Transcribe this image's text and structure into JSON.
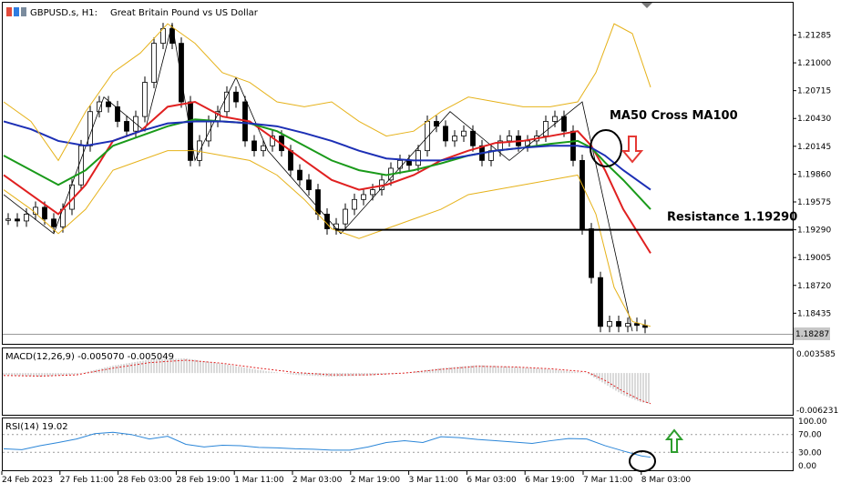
{
  "header": {
    "symbol": "GBPUSD.s, H1:",
    "description": "Great Britain Pound vs US Dollar"
  },
  "price_axis": {
    "ticks": [
      "1.21285",
      "1.21000",
      "1.20715",
      "1.20430",
      "1.20145",
      "1.19860",
      "1.19575",
      "1.19290",
      "1.19005",
      "1.18720",
      "1.18435"
    ],
    "current_price": "1.18287"
  },
  "annotations": {
    "cross_label": "MA50 Cross MA100",
    "resistance_label": "Resistance 1.19290",
    "colors": {
      "down_arrow": "#e53935",
      "up_arrow": "#2e9e2e",
      "resistance_line": "#000000"
    }
  },
  "macd": {
    "label": "MACD(12,26,9) -0.005070 -0.005049",
    "scale_top": "0.003585",
    "scale_bottom": "-0.006231"
  },
  "rsi": {
    "label": "RSI(14) 19.02",
    "levels": [
      "100.00",
      "70.00",
      "30.00",
      "0.00"
    ]
  },
  "time_axis": {
    "labels": [
      "24 Feb 2023",
      "27 Feb 11:00",
      "28 Feb 03:00",
      "28 Feb 19:00",
      "1 Mar 11:00",
      "2 Mar 03:00",
      "2 Mar 19:00",
      "3 Mar 11:00",
      "6 Mar 03:00",
      "6 Mar 19:00",
      "7 Mar 11:00",
      "8 Mar 03:00"
    ]
  },
  "chart_data": {
    "type": "line",
    "symbol": "GBPUSD",
    "timeframe": "H1",
    "price_range": [
      1.1814,
      1.2142
    ],
    "resistance": 1.1929,
    "series": [
      {
        "key": "price",
        "x": [
          0,
          10,
          20,
          30,
          40,
          50,
          60,
          70,
          80,
          90,
          100,
          110,
          120,
          130,
          140,
          150,
          160,
          170,
          180,
          190,
          200,
          210,
          220,
          230,
          240,
          250,
          260,
          270,
          280,
          290,
          300,
          310,
          320,
          330,
          340,
          350,
          360,
          370,
          380,
          390,
          400,
          410,
          420,
          430,
          440,
          450,
          460,
          470,
          480,
          490,
          500,
          510,
          520,
          530,
          540,
          550,
          560,
          570,
          580,
          590,
          600,
          610,
          620,
          630,
          640,
          650,
          660,
          670,
          680,
          690,
          700,
          708
        ],
        "y": [
          1.194,
          1.194,
          1.1938,
          1.1945,
          1.1952,
          1.194,
          1.1932,
          1.195,
          1.1975,
          1.2015,
          1.205,
          1.206,
          1.2055,
          1.204,
          1.203,
          1.2045,
          1.208,
          1.212,
          1.2135,
          1.212,
          1.206,
          1.2,
          1.202,
          1.204,
          1.205,
          1.207,
          1.206,
          1.202,
          1.201,
          1.2015,
          1.2025,
          1.201,
          1.199,
          1.198,
          1.197,
          1.1945,
          1.193,
          1.1935,
          1.195,
          1.196,
          1.1965,
          1.197,
          1.198,
          1.1992,
          1.2,
          1.1995,
          1.201,
          1.204,
          1.2035,
          1.202,
          1.2025,
          1.203,
          1.2015,
          1.2,
          1.201,
          1.202,
          1.2025,
          1.2015,
          1.202,
          1.2025,
          1.204,
          1.2045,
          1.203,
          1.2,
          1.193,
          1.188,
          1.183,
          1.1835,
          1.183,
          1.1833,
          1.1831,
          1.1829
        ]
      },
      {
        "key": "ma_red",
        "color": "#e02020",
        "x": [
          0,
          30,
          60,
          90,
          120,
          150,
          180,
          210,
          240,
          270,
          300,
          330,
          360,
          390,
          420,
          450,
          480,
          510,
          540,
          570,
          600,
          630,
          645,
          660,
          680,
          710
        ],
        "y": [
          1.1985,
          1.1965,
          1.1945,
          1.1975,
          1.202,
          1.203,
          1.2055,
          1.206,
          1.2045,
          1.204,
          1.202,
          1.2,
          1.198,
          1.197,
          1.1975,
          1.1985,
          1.2,
          1.201,
          1.2018,
          1.202,
          1.2025,
          1.203,
          1.2015,
          1.199,
          1.195,
          1.1905
        ]
      },
      {
        "key": "ma_green",
        "color": "#1a9a1a",
        "x": [
          0,
          30,
          60,
          90,
          120,
          150,
          180,
          210,
          240,
          270,
          300,
          330,
          360,
          390,
          420,
          450,
          480,
          510,
          540,
          570,
          600,
          630,
          645,
          660,
          680,
          710
        ],
        "y": [
          1.2005,
          1.199,
          1.1975,
          1.199,
          1.2015,
          1.2025,
          1.2035,
          1.2042,
          1.204,
          1.2038,
          1.203,
          1.2015,
          1.2,
          1.199,
          1.1985,
          1.199,
          1.1997,
          1.2005,
          1.201,
          1.2013,
          1.2017,
          1.202,
          1.2013,
          1.1998,
          1.198,
          1.195
        ]
      },
      {
        "key": "ma_blue",
        "color": "#1c2fb5",
        "x": [
          0,
          30,
          60,
          90,
          120,
          150,
          180,
          210,
          240,
          270,
          300,
          330,
          360,
          390,
          420,
          450,
          480,
          510,
          540,
          570,
          600,
          630,
          645,
          660,
          680,
          710
        ],
        "y": [
          1.204,
          1.2032,
          1.202,
          1.2015,
          1.202,
          1.203,
          1.2038,
          1.204,
          1.204,
          1.2038,
          1.2035,
          1.2028,
          1.202,
          1.201,
          1.2002,
          1.2,
          1.2,
          1.2005,
          1.201,
          1.2013,
          1.2015,
          1.2015,
          1.2013,
          1.2005,
          1.199,
          1.197
        ]
      },
      {
        "key": "bb_upper",
        "color": "#e6b21a",
        "x": [
          0,
          30,
          60,
          90,
          120,
          150,
          180,
          210,
          240,
          270,
          300,
          330,
          360,
          390,
          420,
          450,
          480,
          510,
          540,
          570,
          600,
          630,
          650,
          670,
          690,
          710
        ],
        "y": [
          1.206,
          1.204,
          1.2,
          1.205,
          1.209,
          1.211,
          1.214,
          1.212,
          1.209,
          1.208,
          1.206,
          1.2055,
          1.206,
          1.204,
          1.2025,
          1.203,
          1.205,
          1.2065,
          1.206,
          1.2055,
          1.2055,
          1.206,
          1.209,
          1.214,
          1.213,
          1.2075
        ]
      },
      {
        "key": "bb_lower",
        "color": "#e6b21a",
        "x": [
          0,
          30,
          60,
          90,
          120,
          150,
          180,
          210,
          240,
          270,
          300,
          330,
          360,
          390,
          420,
          450,
          480,
          510,
          540,
          570,
          600,
          630,
          650,
          670,
          690,
          710
        ],
        "y": [
          1.197,
          1.195,
          1.1925,
          1.195,
          1.199,
          1.2,
          1.201,
          1.201,
          1.2005,
          1.2,
          1.1985,
          1.196,
          1.193,
          1.192,
          1.193,
          1.194,
          1.195,
          1.1965,
          1.197,
          1.1975,
          1.198,
          1.1985,
          1.1945,
          1.187,
          1.1835,
          1.183
        ]
      }
    ],
    "macd": {
      "range": [
        -0.006231,
        0.003585
      ],
      "x": [
        0,
        40,
        80,
        120,
        160,
        200,
        240,
        280,
        320,
        360,
        400,
        440,
        480,
        520,
        560,
        600,
        640,
        660,
        680,
        700,
        710
      ],
      "histogram": [
        -0.0003,
        -0.0006,
        -0.0002,
        0.0012,
        0.0022,
        0.0024,
        0.0015,
        0.0005,
        -0.0003,
        -0.0006,
        -0.0004,
        0.0,
        0.0008,
        0.0013,
        0.001,
        0.0006,
        0.0,
        -0.0018,
        -0.0036,
        -0.0048,
        -0.005
      ],
      "signal": [
        -0.0004,
        -0.0005,
        -0.0003,
        0.0008,
        0.0017,
        0.0021,
        0.0016,
        0.0008,
        0.0001,
        -0.0003,
        -0.0003,
        0.0,
        0.0006,
        0.0011,
        0.001,
        0.0007,
        0.0002,
        -0.0012,
        -0.003,
        -0.0045,
        -0.005
      ]
    },
    "rsi": {
      "range": [
        0,
        100
      ],
      "x": [
        0,
        20,
        40,
        60,
        80,
        100,
        120,
        140,
        160,
        180,
        200,
        220,
        240,
        260,
        280,
        300,
        320,
        340,
        360,
        380,
        400,
        420,
        440,
        460,
        480,
        500,
        520,
        540,
        560,
        580,
        600,
        620,
        640,
        660,
        680,
        700,
        710
      ],
      "y": [
        38,
        36,
        45,
        52,
        60,
        72,
        75,
        70,
        60,
        66,
        48,
        42,
        46,
        45,
        41,
        40,
        38,
        37,
        35,
        35,
        42,
        52,
        56,
        52,
        65,
        63,
        59,
        56,
        53,
        50,
        56,
        61,
        60,
        45,
        33,
        22,
        19
      ]
    }
  }
}
